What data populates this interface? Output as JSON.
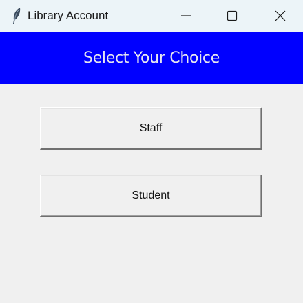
{
  "window": {
    "title": "Library Account",
    "icon": "feather-icon",
    "controls": [
      "minimize-icon",
      "maximize-icon",
      "close-icon"
    ]
  },
  "header": {
    "text": "Select Your Choice",
    "background": "#0000ff"
  },
  "buttons": {
    "staff_label": "Staff",
    "student_label": "Student"
  }
}
